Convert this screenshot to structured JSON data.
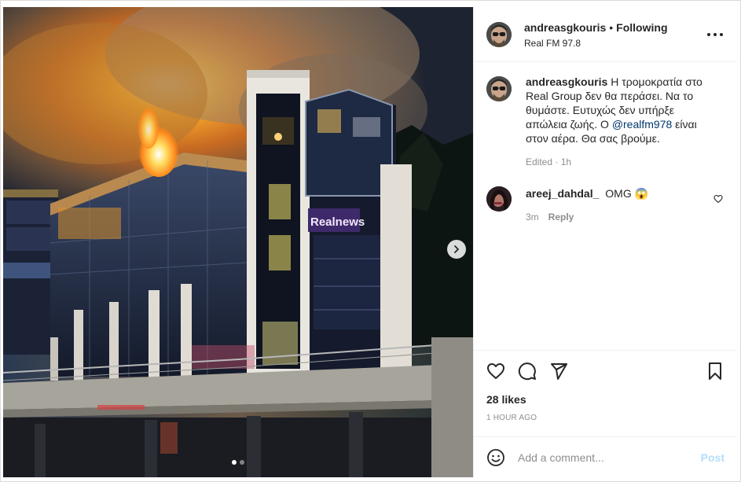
{
  "post": {
    "username": "andreasgkouris",
    "separator": "•",
    "follow_status": "Following",
    "location": "Real FM 97.8",
    "more_icon": "more-options-icon"
  },
  "media": {
    "sign_text": "Realnews",
    "carousel": {
      "current": 1,
      "total": 2
    },
    "next_icon": "chevron-right-icon"
  },
  "caption": {
    "username": "andreasgkouris",
    "text_before": "Η τρομοκρατία στο Real Group δεν θα περάσει. Να το θυμάστε. Ευτυχώς δεν υπήρξε απώλεια ζωής. Ο ",
    "mention": "@realfm978",
    "text_after": " είναι στον αέρα. Θα σας βρούμε.",
    "meta": "Edited · 1h"
  },
  "comments": [
    {
      "username": "areej_dahdal_",
      "text": "OMG 😱",
      "time": "3m",
      "reply_label": "Reply"
    }
  ],
  "actions": {
    "icons": [
      "heart-icon",
      "comment-icon",
      "share-icon",
      "bookmark-icon"
    ],
    "likes": "28 likes",
    "time_ago": "1 HOUR AGO"
  },
  "add_comment": {
    "placeholder": "Add a comment...",
    "post_label": "Post"
  },
  "colors": {
    "link": "#00376b",
    "muted": "#8e8e8e",
    "post_disabled": "#b2dffc",
    "text": "#262626"
  }
}
